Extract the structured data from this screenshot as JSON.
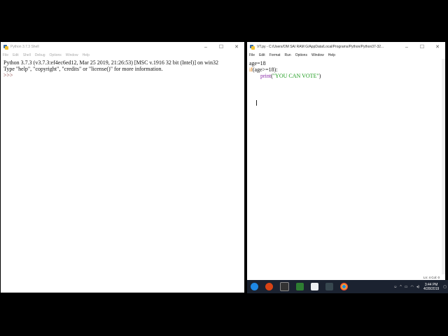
{
  "shell": {
    "title": "Python 3.7.3 Shell",
    "menu": [
      "File",
      "Edit",
      "Shell",
      "Debug",
      "Options",
      "Window",
      "Help"
    ],
    "lines": [
      "Python 3.7.3 (v3.7.3:ef4ec6ed12, Mar 25 2019, 21:26:53) [MSC v.1916 32 bit (Intel)] on win32",
      "Type \"help\", \"copyright\", \"credits\" or \"license()\" for more information."
    ],
    "prompt": ">>>"
  },
  "editor": {
    "title": "VT.py - C:/Users/OM SAI RAM G/AppData/Local/Programs/Python/Python37-32...",
    "menu": [
      "File",
      "Edit",
      "Format",
      "Run",
      "Options",
      "Window",
      "Help"
    ],
    "code": {
      "line1": "age=18",
      "line2_kw": "if",
      "line2_rest": "(age>=18):",
      "line3_indent": "        ",
      "line3_fn": "print",
      "line3_open": "(",
      "line3_str": "\"YOU CAN VOTE\"",
      "line3_close": ")"
    },
    "status": "Ln: 4   Col: 0"
  },
  "window_controls": {
    "minimize": "–",
    "maximize": "☐",
    "close": "✕"
  },
  "taskbar": {
    "clock_time": "3:44 PM",
    "clock_date": "4/28/2019",
    "icons": [
      "idle-icon",
      "app-icon",
      "terminal-icon",
      "image-icon",
      "file-icon",
      "python-icon",
      "chrome-icon"
    ]
  },
  "colors": {
    "keyword": "#e07800",
    "string": "#1a9a1a",
    "builtin": "#8a2ba8",
    "taskbar": "#1b2230"
  }
}
